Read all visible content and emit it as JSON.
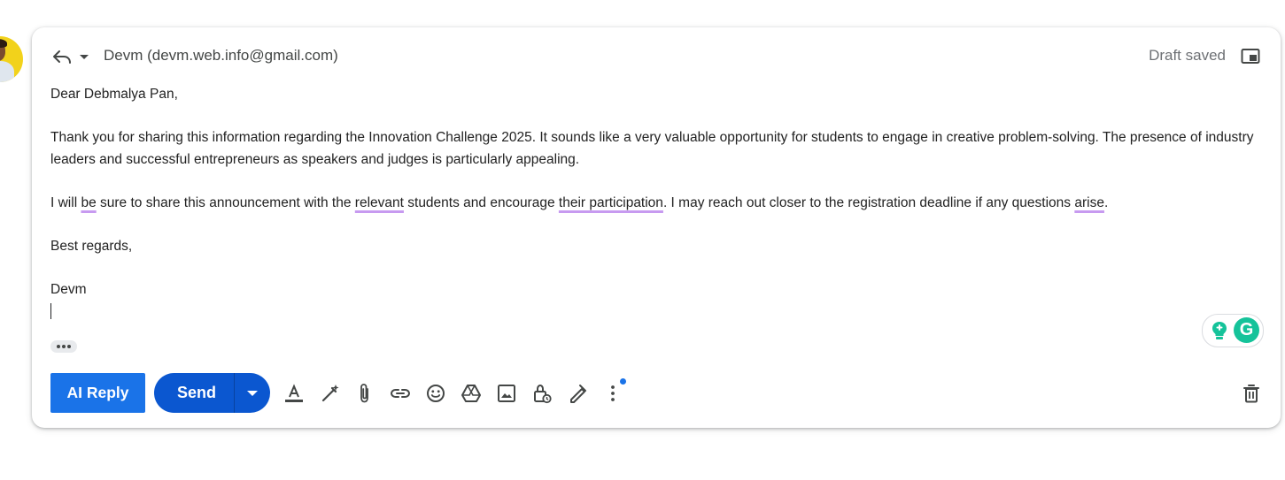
{
  "avatar": {
    "icon": "user-avatar",
    "color": "#f2d21b"
  },
  "header": {
    "reply_icon": "reply-icon",
    "reply_menu_icon": "caret-down-icon",
    "recipient": "Devm (devm.web.info@gmail.com)",
    "status": "Draft saved",
    "popout_icon": "popout-icon"
  },
  "body": {
    "greeting": "Dear Debmalya Pan,",
    "paragraph1": "Thank you for sharing this information regarding the Innovation Challenge 2025. It sounds like a very valuable opportunity for students to engage in creative problem-solving. The presence of industry leaders and successful entrepreneurs as speakers and judges is particularly appealing.",
    "p2": {
      "t1": "I will ",
      "u1": "be",
      "t2": " sure to share this announcement with the ",
      "u2": "relevant",
      "t3": " students and encourage ",
      "u3": "their participation",
      "t4": ". I may reach out closer to the registration deadline if any questions ",
      "u4": "arise",
      "t5": "."
    },
    "closing": "Best regards,",
    "signature": "Devm"
  },
  "grammarly": {
    "suggestions_icon": "lightbulb-icon",
    "logo_text": "G",
    "color": "#15c39a"
  },
  "footer": {
    "ai_reply_label": "AI Reply",
    "send_label": "Send",
    "send_options_icon": "caret-down-icon",
    "tools": [
      "formatting-options-icon",
      "ai-write-icon",
      "attach-file-icon",
      "insert-link-icon",
      "insert-emoji-icon",
      "insert-drive-file-icon",
      "insert-photo-icon",
      "confidential-mode-icon",
      "insert-signature-icon",
      "more-options-icon"
    ],
    "delete_icon": "trash-icon",
    "accent_color": "#0b57d0"
  }
}
